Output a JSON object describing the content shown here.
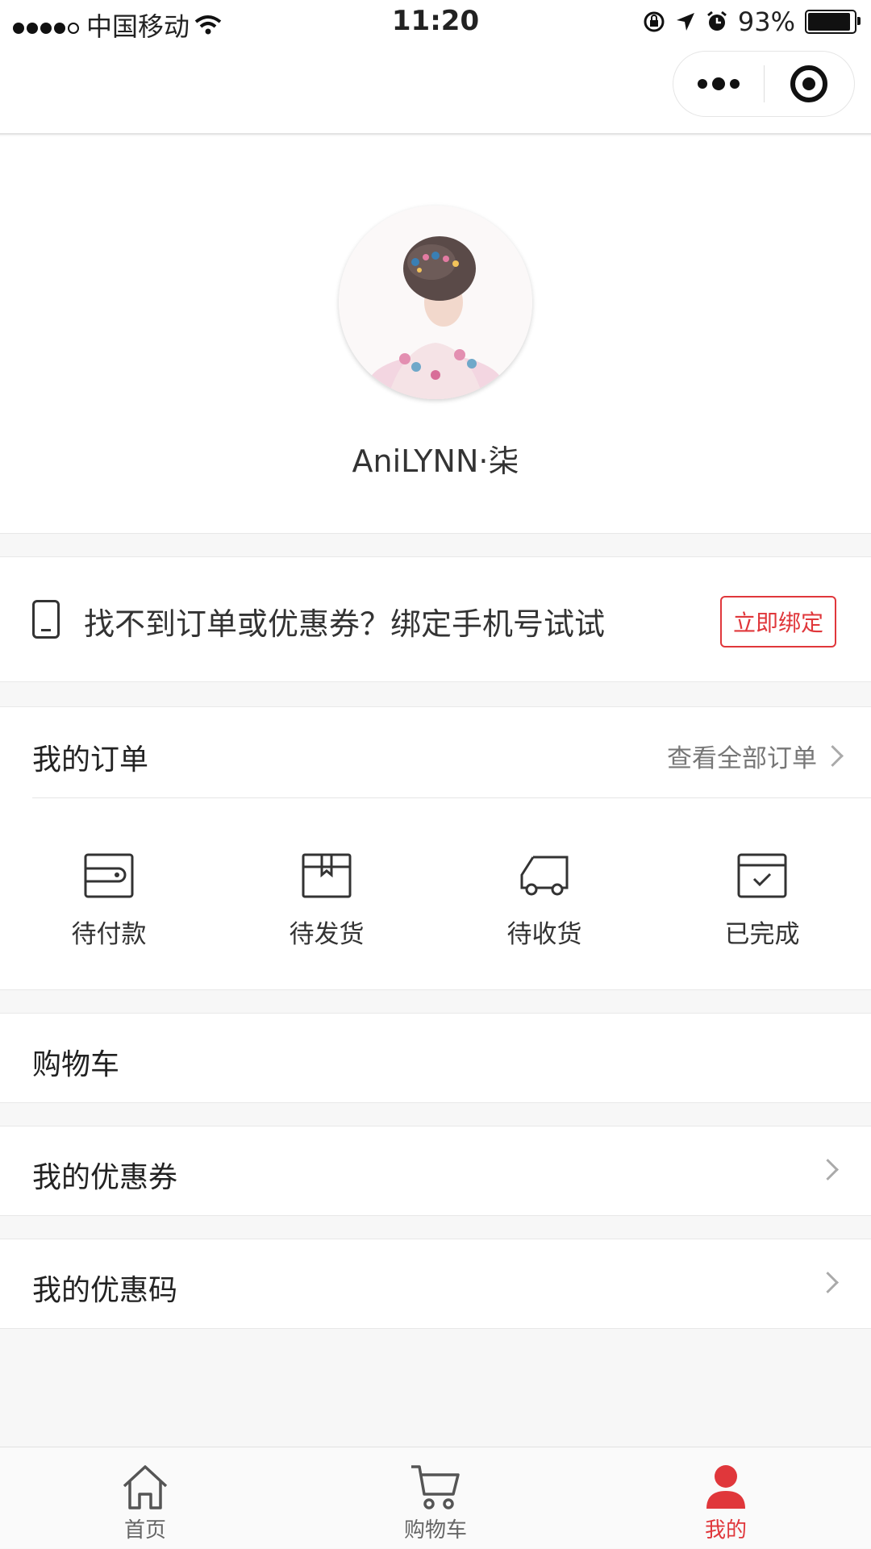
{
  "status_bar": {
    "carrier": "中国移动",
    "time": "11:20",
    "battery": "93%"
  },
  "profile": {
    "username": "AniLYNN·柒"
  },
  "bind_phone": {
    "text": "找不到订单或优惠券？绑定手机号试试",
    "button": "立即绑定"
  },
  "orders": {
    "title": "我的订单",
    "view_all": "查看全部订单",
    "items": [
      {
        "label": "待付款",
        "icon": "wallet-icon"
      },
      {
        "label": "待发货",
        "icon": "box-icon"
      },
      {
        "label": "待收货",
        "icon": "truck-icon"
      },
      {
        "label": "已完成",
        "icon": "calendar-check-icon"
      }
    ]
  },
  "menu": {
    "cart": "购物车",
    "coupons": "我的优惠券",
    "promo_codes": "我的优惠码"
  },
  "tab_bar": {
    "items": [
      {
        "label": "首页",
        "icon": "home-icon"
      },
      {
        "label": "购物车",
        "icon": "cart-icon"
      },
      {
        "label": "我的",
        "icon": "user-icon"
      }
    ],
    "active_index": 2,
    "active_color": "#e0373b"
  }
}
